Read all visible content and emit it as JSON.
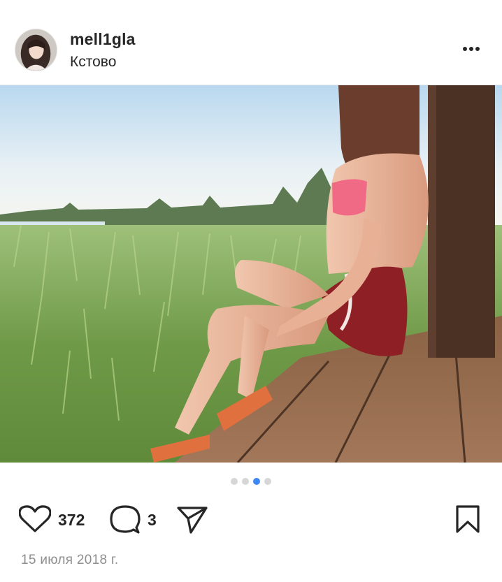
{
  "post": {
    "username": "mell1gla",
    "location": "Кстово",
    "likes_count": "372",
    "comments_count": "3",
    "date": "15 июля 2018 г.",
    "carousel": {
      "total": 4,
      "active_index": 2
    }
  },
  "icons": {
    "more": "more-options-icon",
    "like": "heart-icon",
    "comment": "comment-bubble-icon",
    "share": "send-icon",
    "save": "bookmark-icon"
  },
  "colors": {
    "text": "#262626",
    "muted": "#8e8e8e",
    "active_dot": "#3f87f5",
    "inactive_dot": "#d6d6d6"
  }
}
